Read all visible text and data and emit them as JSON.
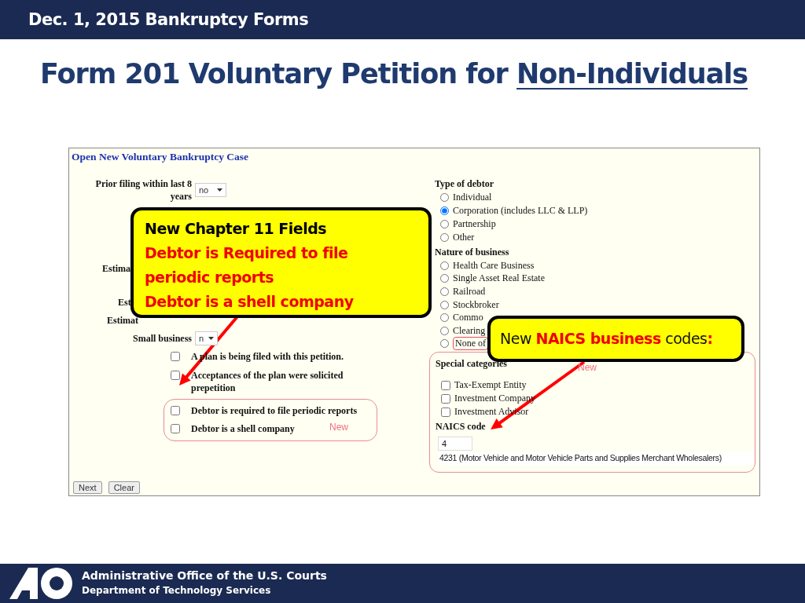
{
  "header": {
    "title": "Dec. 1, 2015 Bankruptcy Forms"
  },
  "title_parts": [
    {
      "text": "Form 201 Voluntary Petition for",
      "underline": false
    },
    {
      "text": "Non-Individuals",
      "underline": true
    }
  ],
  "form": {
    "title": "Open New Voluntary Bankruptcy Case",
    "left_rows": [
      {
        "kind": "select",
        "label": "Prior filing within last 8 years",
        "value": "no"
      },
      {
        "kind": "cut",
        "label": "Estima"
      },
      {
        "kind": "cut",
        "label": "Est"
      },
      {
        "kind": "cut",
        "label": "Estimat"
      },
      {
        "kind": "select",
        "label": "Small business",
        "value": "n"
      }
    ],
    "plan_checks": [
      {
        "label": "A plan is being filed with this petition.",
        "checked": false
      },
      {
        "label": "Acceptances of the plan were solicited prepetition",
        "checked": false
      }
    ],
    "new_checks": [
      {
        "label": "Debtor is required to file periodic reports",
        "checked": false
      },
      {
        "label": "Debtor is a shell company",
        "checked": false
      }
    ],
    "new_note": "New",
    "type_of_debtor": {
      "label": "Type of debtor",
      "options": [
        {
          "label": "Individual",
          "selected": false
        },
        {
          "label": "Corporation (includes LLC & LLP)",
          "selected": true
        },
        {
          "label": "Partnership",
          "selected": false
        },
        {
          "label": "Other",
          "selected": false
        }
      ]
    },
    "nature_of_business": {
      "label": "Nature of business",
      "options": [
        {
          "label": "Health Care Business",
          "selected": false,
          "circled": false
        },
        {
          "label": "Single Asset Real Estate",
          "selected": false,
          "circled": false
        },
        {
          "label": "Railroad",
          "selected": false,
          "circled": false
        },
        {
          "label": "Stockbroker",
          "selected": false,
          "circled": false
        },
        {
          "label": "Commo",
          "selected": false,
          "circled": false
        },
        {
          "label": "Clearing",
          "selected": false,
          "circled": false
        },
        {
          "label": "None of",
          "selected": false,
          "circled": true
        }
      ]
    },
    "special_categories": {
      "label": "Special categories",
      "note": "New",
      "options": [
        {
          "label": "Tax-Exempt Entity",
          "checked": false
        },
        {
          "label": "Investment Company",
          "checked": false
        },
        {
          "label": "Investment Advisor",
          "checked": false
        }
      ]
    },
    "naics": {
      "label": "NAICS code",
      "value": "4",
      "match": "4231 (Motor Vehicle and Motor Vehicle Parts and Supplies Merchant Wholesalers)"
    },
    "buttons": [
      "Next",
      "Clear"
    ]
  },
  "callouts": [
    {
      "heading": "New Chapter 11 Fields",
      "items": [
        "Debtor is Required to file periodic reports",
        "Debtor is a shell company"
      ]
    },
    {
      "text": "New **NAICS business** codes**:**"
    }
  ],
  "footer": {
    "lines": [
      "Administrative Office of the U.S. Courts",
      "Department of Technology Services"
    ]
  }
}
